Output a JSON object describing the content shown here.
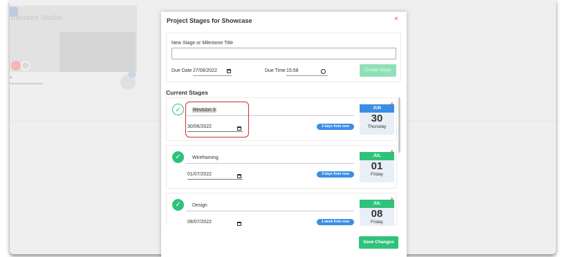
{
  "background": {
    "card_title": "Interiors Studio"
  },
  "modal": {
    "title": "Project Stages for Showcase",
    "close_glyph": "×",
    "new_stage": {
      "label": "New Stage or Milestone Title",
      "title_value": "",
      "due_date_label": "Due Date",
      "due_date_value": "27/06/2022",
      "due_time_label": "Due Time",
      "due_time_value": "15:58",
      "create_button": "Create Stage"
    },
    "current_stages_heading": "Current Stages",
    "stages": [
      {
        "title": "Revision 3",
        "date": "30/06/2022",
        "due_text": "2 days from now",
        "month": "JUN",
        "day": "30",
        "weekday": "Thursday",
        "completed": false,
        "remove_glyph": "×"
      },
      {
        "title": "Wireframing",
        "date": "01/07/2022",
        "due_text": "3 days from now",
        "month": "JUL",
        "day": "01",
        "weekday": "Friday",
        "completed": true,
        "remove_glyph": "×"
      },
      {
        "title": "Design",
        "date": "08/07/2022",
        "due_text": "1 week from now",
        "month": "JUL",
        "day": "08",
        "weekday": "Friday",
        "completed": true,
        "remove_glyph": "×"
      }
    ],
    "save_button": "Save Changes"
  },
  "colors": {
    "accent_green": "#2fc27a",
    "accent_blue": "#3a8fe5",
    "danger": "#e23b3b",
    "create_disabled": "#8fe0b7"
  },
  "icons": {
    "check": "check-icon",
    "calendar": "calendar-icon",
    "clock": "clock-icon",
    "close": "close-icon"
  }
}
